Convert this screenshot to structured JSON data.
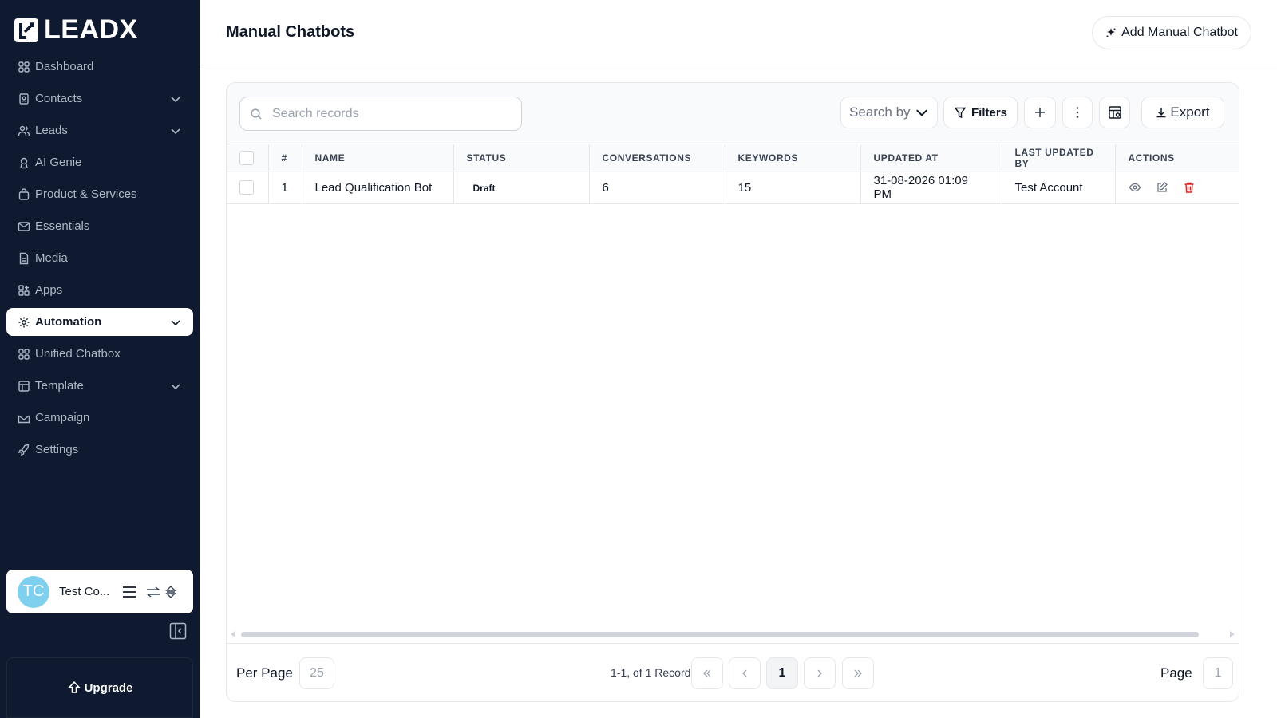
{
  "brand": {
    "name": "LEADX"
  },
  "sidebar": {
    "items": [
      {
        "label": "Dashboard",
        "icon": "grid-icon",
        "has_chevron": false,
        "active": false
      },
      {
        "label": "Contacts",
        "icon": "contact-book-icon",
        "has_chevron": true,
        "active": false
      },
      {
        "label": "Leads",
        "icon": "users-icon",
        "has_chevron": true,
        "active": false
      },
      {
        "label": "AI Genie",
        "icon": "bot-icon",
        "has_chevron": false,
        "active": false
      },
      {
        "label": "Product & Services",
        "icon": "bag-icon",
        "has_chevron": false,
        "active": false
      },
      {
        "label": "Essentials",
        "icon": "mail-icon",
        "has_chevron": false,
        "active": false
      },
      {
        "label": "Media",
        "icon": "file-icon",
        "has_chevron": false,
        "active": false
      },
      {
        "label": "Apps",
        "icon": "apps-icon",
        "has_chevron": false,
        "active": false
      },
      {
        "label": "Automation",
        "icon": "gear-icon",
        "has_chevron": true,
        "active": true
      },
      {
        "label": "Unified Chatbox",
        "icon": "grid-icon",
        "has_chevron": false,
        "active": false
      },
      {
        "label": "Template",
        "icon": "template-icon",
        "has_chevron": true,
        "active": false
      },
      {
        "label": "Campaign",
        "icon": "mail-open-icon",
        "has_chevron": false,
        "active": false
      },
      {
        "label": "Settings",
        "icon": "rocket-icon",
        "has_chevron": false,
        "active": false
      }
    ],
    "user": {
      "initials": "TC",
      "name": "Test Co..."
    },
    "upgrade_label": "Upgrade"
  },
  "header": {
    "title": "Manual Chatbots",
    "add_button_label": "Add Manual Chatbot"
  },
  "toolbar": {
    "search_placeholder": "Search records",
    "search_by_label": "Search by",
    "filters_label": "Filters",
    "export_label": "Export"
  },
  "table": {
    "columns": [
      "#",
      "NAME",
      "STATUS",
      "CONVERSATIONS",
      "KEYWORDS",
      "UPDATED AT",
      "LAST UPDATED BY",
      "ACTIONS"
    ],
    "rows": [
      {
        "index": "1",
        "name": "Lead Qualification Bot",
        "status": "Draft",
        "conversations": "6",
        "keywords": "15",
        "updated_at": "31-08-2026 01:09 PM",
        "last_updated_by": "Test Account"
      }
    ]
  },
  "pagination": {
    "per_page_label": "Per Page",
    "per_page_value": "25",
    "records_text": "1-1, of 1 Records",
    "current_page": "1",
    "page_label": "Page",
    "page_value": "1"
  },
  "colors": {
    "sidebar_bg": "#0f1a30",
    "sidebar_text": "#aeb7c6",
    "avatar_bg": "#7fd0ee",
    "delete_red": "#dc2626"
  }
}
